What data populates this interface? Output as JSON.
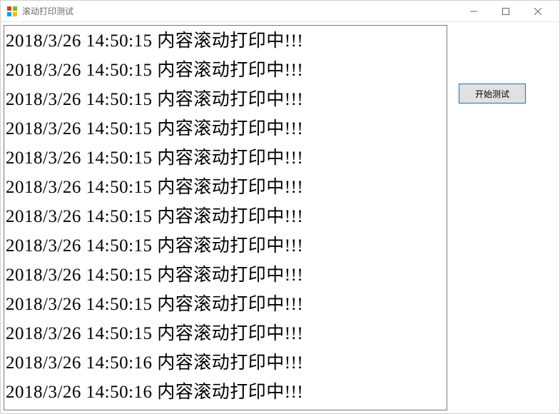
{
  "window": {
    "title": "滚动打印测试"
  },
  "button": {
    "start": "开始测试"
  },
  "log": {
    "items": [
      "2018/3/26  14:50:15  内容滚动打印中!!!",
      "2018/3/26  14:50:15  内容滚动打印中!!!",
      "2018/3/26  14:50:15  内容滚动打印中!!!",
      "2018/3/26  14:50:15  内容滚动打印中!!!",
      "2018/3/26  14:50:15  内容滚动打印中!!!",
      "2018/3/26  14:50:15  内容滚动打印中!!!",
      "2018/3/26  14:50:15  内容滚动打印中!!!",
      "2018/3/26  14:50:15  内容滚动打印中!!!",
      "2018/3/26  14:50:15  内容滚动打印中!!!",
      "2018/3/26  14:50:15  内容滚动打印中!!!",
      "2018/3/26  14:50:15  内容滚动打印中!!!",
      "2018/3/26  14:50:16  内容滚动打印中!!!",
      "2018/3/26  14:50:16  内容滚动打印中!!!"
    ]
  }
}
